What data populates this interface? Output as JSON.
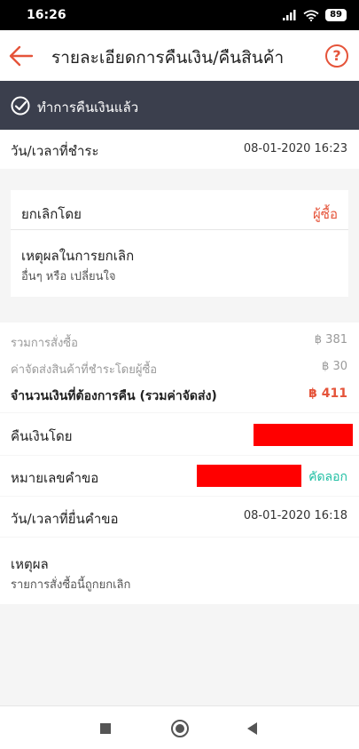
{
  "status_bar": {
    "time": "16:26",
    "battery": "89"
  },
  "header": {
    "title": "รายละเอียดการคืนเงิน/คืนสินค้า",
    "help": "?"
  },
  "banner": {
    "text": "ทำการคืนเงินแล้ว"
  },
  "payment_time": {
    "label": "วัน/เวลาที่ชำระ",
    "value": "08-01-2020 16:23"
  },
  "cancellation": {
    "cancelled_by_label": "ยกเลิกโดย",
    "cancelled_by_value": "ผู้ซื้อ",
    "reason_label": "เหตุผลในการยกเลิก",
    "reason_value": "อื่นๆ หรือ เปลี่ยนใจ"
  },
  "summary": {
    "order_total_label": "รวมการสั่งซื้อ",
    "order_total_value": "฿ 381",
    "shipping_label": "ค่าจัดส่งสินค้าที่ชำระโดยผู้ซื้อ",
    "shipping_value": "฿ 30",
    "refund_label": "จำนวนเงินที่ต้องการคืน (รวมค่าจัดส่ง)",
    "refund_value": "฿ 411"
  },
  "refund_method": {
    "label": "คืนเงินโดย"
  },
  "request_number": {
    "label": "หมายเลขคำขอ",
    "copy": "คัดลอก"
  },
  "request_time": {
    "label": "วัน/เวลาที่ยื่นคำขอ",
    "value": "08-01-2020 16:18"
  },
  "reason": {
    "label": "เหตุผล",
    "value": "รายการสั่งซื้อนี้ถูกยกเลิก"
  },
  "colors": {
    "accent": "#e5543a",
    "banner": "#3b3f4d",
    "copy": "#1fbfa3",
    "redaction": "#ff0000"
  },
  "icons": [
    "signal-icon",
    "wifi-icon",
    "battery-icon",
    "back-arrow-icon",
    "help-icon",
    "check-circle-icon",
    "nav-recents-icon",
    "nav-home-icon",
    "nav-back-icon"
  ]
}
